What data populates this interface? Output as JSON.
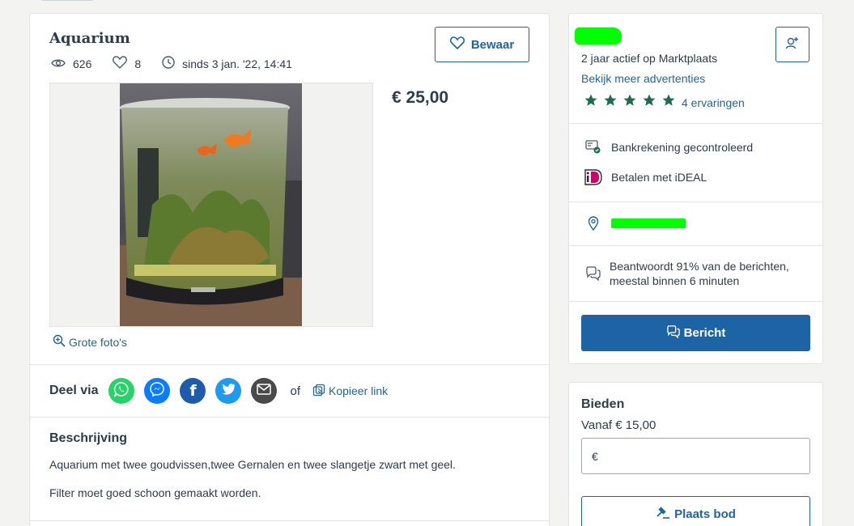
{
  "listing": {
    "title": "Aquarium",
    "views": "626",
    "favorites": "8",
    "since": "sinds 3 jan. '22, 14:41",
    "save_label": "Bewaar",
    "price": "€ 25,00",
    "large_photos_label": "Grote foto's"
  },
  "share": {
    "label": "Deel via",
    "or": "of",
    "copy_link": "Kopieer link",
    "channels": [
      "whatsapp",
      "messenger",
      "facebook",
      "twitter",
      "email"
    ]
  },
  "description": {
    "title": "Beschrijving",
    "line1": "Aquarium met twee goudvissen,twee Gernalen en twee slangetje zwart met geel.",
    "line2": "Filter moet goed schoon gemaakt worden."
  },
  "seller": {
    "active": "2 jaar actief op Marktplaats",
    "more_ads": "Bekijk meer advertenties",
    "rating_stars": 5,
    "reviews": "4 ervaringen",
    "bank_verified": "Bankrekening gecontroleerd",
    "ideal": "Betalen met iDEAL",
    "response_line1": "Beantwoordt 91% van de berichten,",
    "response_line2": "meestal binnen 6 minuten",
    "message_button": "Bericht"
  },
  "bid": {
    "title": "Bieden",
    "minimum": "Vanaf € 15,00",
    "currency": "€",
    "place_bid": "Plaats bod"
  },
  "colors": {
    "brand_blue": "#1d64a7",
    "star_green": "#1f6b4f",
    "text": "#2d3c4d"
  }
}
